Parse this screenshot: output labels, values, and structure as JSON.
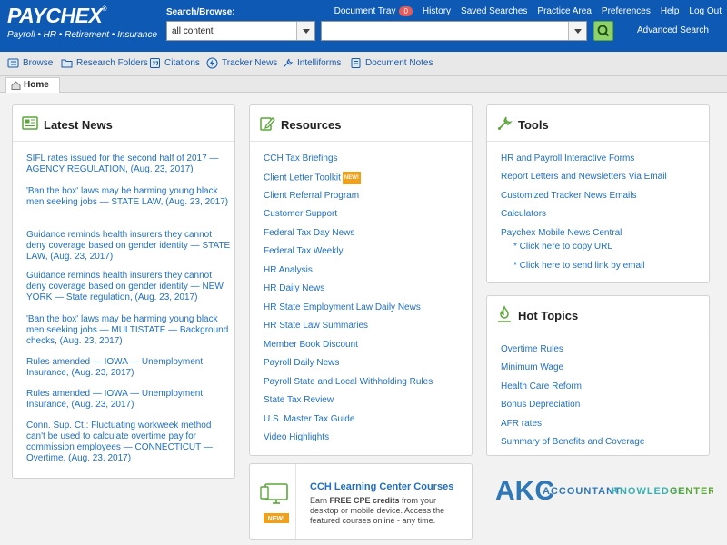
{
  "header": {
    "logo": "PAYCHEX",
    "tagline": "Payroll • HR • Retirement • Insurance",
    "search_label": "Search/Browse:",
    "select_value": "all content",
    "search_placeholder": "",
    "advanced_search": "Advanced Search",
    "top_links": {
      "document_tray": "Document Tray",
      "tray_count": "0",
      "history": "History",
      "saved_searches": "Saved Searches",
      "practice_area": "Practice Area",
      "preferences": "Preferences",
      "help": "Help",
      "logout": "Log Out"
    }
  },
  "toolbar": {
    "browse": "Browse",
    "research_folders": "Research Folders",
    "citations": "Citations",
    "tracker_news": "Tracker News",
    "intelliforms": "Intelliforms",
    "document_notes": "Document Notes"
  },
  "tabs": {
    "home": "Home"
  },
  "latest_news": {
    "title": "Latest News",
    "items": [
      "SIFL rates issued for the second half of 2017 — AGENCY REGULATION, (Aug. 23, 2017)",
      "'Ban the box' laws may be harming young black men seeking jobs — STATE LAW, (Aug. 23, 2017)",
      "Guidance reminds health insurers they cannot deny coverage based on gender identity — STATE LAW, (Aug. 23, 2017)",
      "Guidance reminds health insurers they cannot deny coverage based on gender identity — NEW YORK — State regulation, (Aug. 23, 2017)",
      "'Ban the box' laws may be harming young black men seeking jobs — MULTISTATE — Background checks, (Aug. 23, 2017)",
      "Rules amended — IOWA — Unemployment Insurance, (Aug. 23, 2017)",
      "Rules amended — IOWA — Unemployment Insurance, (Aug. 23, 2017)",
      "Conn. Sup. Ct.: Fluctuating workweek method can't be used to calculate overtime pay for commission employees — CONNECTICUT — Overtime, (Aug. 23, 2017)"
    ]
  },
  "resources": {
    "title": "Resources",
    "new_tag": "NEW!",
    "items": [
      "CCH Tax Briefings",
      "Client Letter Toolkit",
      "Client Referral Program",
      "Customer Support",
      "Federal Tax Day News",
      "Federal Tax Weekly",
      "HR Analysis",
      "HR Daily News",
      "HR State Employment Law Daily News",
      "HR State Law Summaries",
      "Member Book Discount",
      "Payroll Daily News",
      "Payroll State and Local Withholding Rules",
      "State Tax Review",
      "U.S. Master Tax Guide",
      "Video Highlights"
    ]
  },
  "tools": {
    "title": "Tools",
    "items": [
      "HR and Payroll Interactive Forms",
      "Report Letters and Newsletters Via Email",
      "Customized Tracker News Emails",
      "Calculators",
      "Paychex Mobile News Central",
      "* Click here to copy URL",
      "* Click here to send link by email"
    ]
  },
  "hot_topics": {
    "title": "Hot Topics",
    "items": [
      "Overtime Rules",
      "Minimum Wage",
      "Health Care Reform",
      "Bonus Depreciation",
      "AFR rates",
      "Summary of Benefits and Coverage"
    ]
  },
  "learning_center": {
    "title": "CCH Learning Center Courses",
    "desc_prefix": "Earn ",
    "desc_bold": "FREE CPE credits",
    "desc_rest": " from your desktop or mobile device. Access the featured courses online - any time.",
    "new_tag": "NEW!"
  },
  "akc": {
    "letters": "AKC",
    "word1": "ACCOUNTANT",
    "word2": "KNOWLEDGE",
    "word3": "CENTER"
  }
}
